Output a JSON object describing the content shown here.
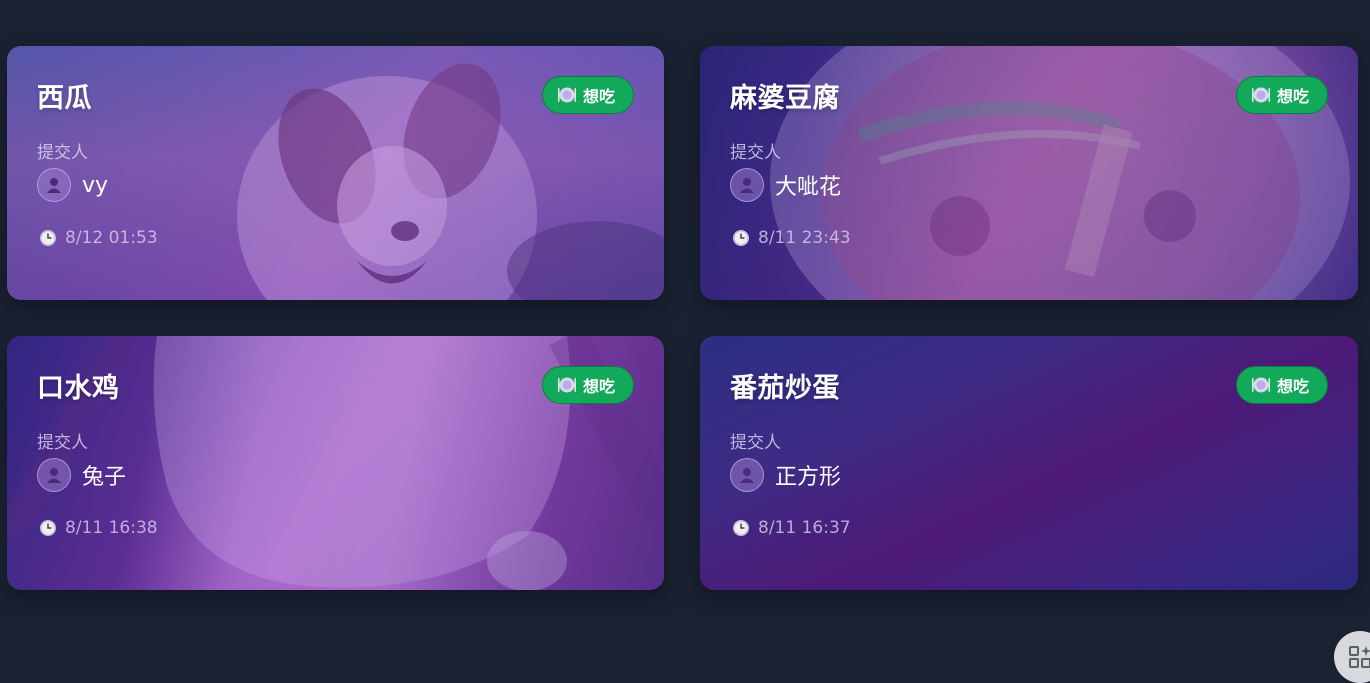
{
  "cards": [
    {
      "title": "西瓜",
      "badge": "想吃",
      "submitter_label": "提交人",
      "submitter": "vy",
      "time": "8/12 01:53",
      "image": "dog-photo"
    },
    {
      "title": "麻婆豆腐",
      "badge": "想吃",
      "submitter_label": "提交人",
      "submitter": "大呲花",
      "time": "8/11 23:43",
      "image": "noodle-bowl-photo"
    },
    {
      "title": "口水鸡",
      "badge": "想吃",
      "submitter_label": "提交人",
      "submitter": "兔子",
      "time": "8/11 16:38",
      "image": "chicken-photo"
    },
    {
      "title": "番茄炒蛋",
      "badge": "想吃",
      "submitter_label": "提交人",
      "submitter": "正方形",
      "time": "8/11 16:37",
      "image": null
    }
  ],
  "icons": {
    "badge": "plate-icon",
    "time": "clock-icon",
    "avatar": "user-icon",
    "fab": "apps-icon"
  },
  "colors": {
    "page_bg": "#1a2232",
    "badge_bg": "#13a95a",
    "card_purple": "#4d1a78"
  }
}
